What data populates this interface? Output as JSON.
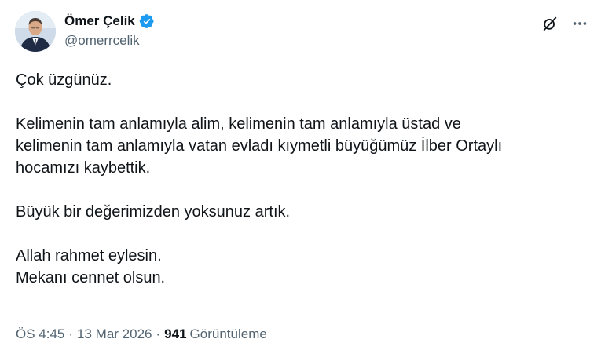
{
  "author": {
    "name": "Ömer Çelik",
    "handle": "@omerrcelik",
    "verified": true,
    "verified_color": "#1d9bf0"
  },
  "icons": {
    "grok": "grok-slash-circle-icon",
    "more": "more-dots-icon"
  },
  "tweet": {
    "line1": "Çok üzgünüz.",
    "para2_line1": "Kelimenin tam anlamıyla alim, kelimenin tam anlamıyla üstad ve",
    "para2_line2": "kelimenin tam anlamıyla vatan evladı kıymetli büyüğümüz İlber Ortaylı",
    "para2_line3": "hocamızı kaybettik.",
    "para3": "Büyük bir değerimizden yoksunuz artık.",
    "para4_line1": "Allah rahmet eylesin.",
    "para4_line2": "Mekanı cennet olsun."
  },
  "meta": {
    "time": "ÖS 4:45",
    "date": "13 Mar 2026",
    "separator": "·",
    "views_count": "941",
    "views_label": "Görüntüleme"
  },
  "colors": {
    "text": "#0f1419",
    "secondary": "#536471",
    "accent": "#1d9bf0"
  }
}
